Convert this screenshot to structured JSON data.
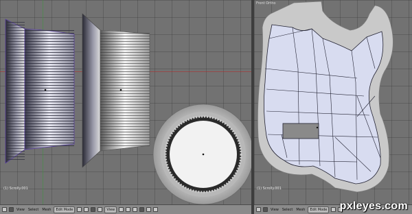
{
  "left_view": {
    "object_label": "(1) Scrolly.001"
  },
  "right_view": {
    "view_title": "Front Ortho",
    "object_label": "(1) Scrolly.001"
  },
  "left_header": {
    "view_menu": "View",
    "select_menu": "Select",
    "mesh_menu": "Mesh",
    "mode_select": "Edit Mode",
    "view_select": "View"
  },
  "right_header": {
    "view_menu": "View",
    "select_menu": "Select",
    "mesh_menu": "Mesh",
    "mode_select": "Edit Mode"
  },
  "watermark": "pxleyes.com",
  "colors": {
    "viewport_bg": "#727272",
    "mesh_fill": "#d8dcf0",
    "mesh_edges": "#202030",
    "header_bg": "#8a8a8a"
  }
}
